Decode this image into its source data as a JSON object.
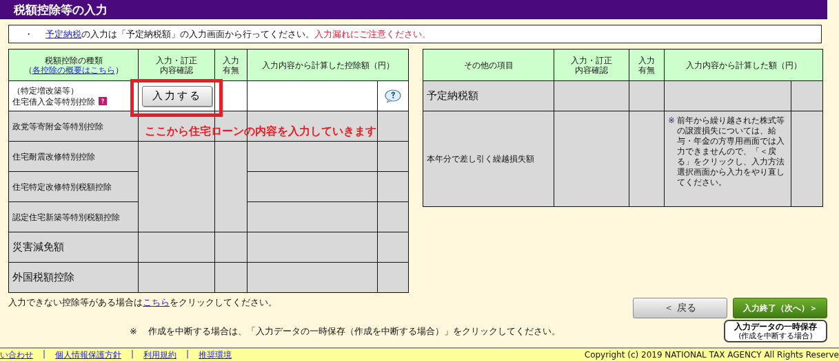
{
  "title": "税額控除等の入力",
  "notice": {
    "bullet": "・",
    "link": "予定納税",
    "text": "の入力は「予定納税額」の入力画面から行ってください。",
    "warning": "入力漏れにご注意ください。"
  },
  "deduction_table": {
    "columns": [
      {
        "lines": [
          "税額控除の種類"
        ],
        "link_prefix": "（",
        "link": "各控除の概要はこちら",
        "link_suffix": "）"
      },
      {
        "lines": [
          "入力・訂正",
          "内容確認"
        ]
      },
      {
        "lines": [
          "入力",
          "有無"
        ]
      },
      {
        "lines": [
          "入力内容から計算した控除額（円）"
        ]
      }
    ],
    "rows": [
      {
        "lines": [
          "（特定増改築等）",
          "住宅借入金等特別控除"
        ],
        "kind": "sub",
        "disabled": false,
        "help_icon": true,
        "button": "入力する",
        "bubble_icon": true,
        "highlighted": true,
        "merged": false
      },
      {
        "lines": [
          "政党等寄附金等特別控除"
        ],
        "kind": "sub",
        "disabled": true,
        "help_icon": false,
        "bubble_icon": false,
        "highlighted": false,
        "merged": false
      },
      {
        "lines": [
          "住宅耐震改修特別控除"
        ],
        "kind": "sub",
        "disabled": true,
        "help_icon": false,
        "bubble_icon": false,
        "highlighted": false,
        "merged": false
      },
      {
        "lines": [
          "住宅特定改修特別税額控除"
        ],
        "kind": "sub",
        "disabled": true,
        "help_icon": false,
        "bubble_icon": false,
        "highlighted": false,
        "merged": true
      },
      {
        "lines": [
          "認定住宅新築等特別税額控除"
        ],
        "kind": "sub",
        "disabled": true,
        "help_icon": false,
        "bubble_icon": false,
        "highlighted": false,
        "merged": true
      },
      {
        "lines": [
          "災害減免額"
        ],
        "kind": "main",
        "disabled": true,
        "help_icon": false,
        "bubble_icon": false,
        "highlighted": false,
        "merged": false
      },
      {
        "lines": [
          "外国税額控除"
        ],
        "kind": "main",
        "disabled": true,
        "help_icon": false,
        "bubble_icon": false,
        "highlighted": false,
        "merged": false
      }
    ]
  },
  "annotation": "ここから住宅ローンの内容を入力していきます",
  "other_table": {
    "columns": [
      {
        "lines": [
          "その他の項目"
        ]
      },
      {
        "lines": [
          "入力・訂正",
          "内容確認"
        ]
      },
      {
        "lines": [
          "入力",
          "有無"
        ]
      },
      {
        "lines": [
          "入力内容から計算した額（円）"
        ]
      }
    ],
    "rows": [
      {
        "lines": [
          "予定納税額"
        ],
        "kind": "main",
        "disabled": true
      },
      {
        "lines": [
          "本年分で差し引く繰越損失額"
        ],
        "kind": "sub",
        "disabled": true,
        "note_mark": "※",
        "note": "前年から繰り越された株式等の譲渡損失については、給与・年金の方専用画面では入力できませんので、「＜戻る」をクリックし、入力方法選択画面から入力をやり直してください。"
      }
    ]
  },
  "unavailable": {
    "text": "入力できない控除等がある場合は",
    "link": "こちら",
    "after": "をクリックしてください。"
  },
  "back_button": "＜ 戻る",
  "next_button": "入力終了（次へ）＞",
  "save_note": {
    "mark": "※",
    "text": "作成を中断する場合は、「入力データの一時保存（作成を中断する場合）」をクリックしてください。"
  },
  "save_button": {
    "line1": "入力データの一時保存",
    "line2": "(作成を中断する場合)"
  },
  "footer": {
    "links": [
      "い合わせ",
      "個人情報保護方針",
      "利用規約",
      "推奨環境"
    ],
    "separator": "|",
    "copyright": "Copyright (c) 2019 NATIONAL TAX AGENCY All Rights Reserve"
  }
}
